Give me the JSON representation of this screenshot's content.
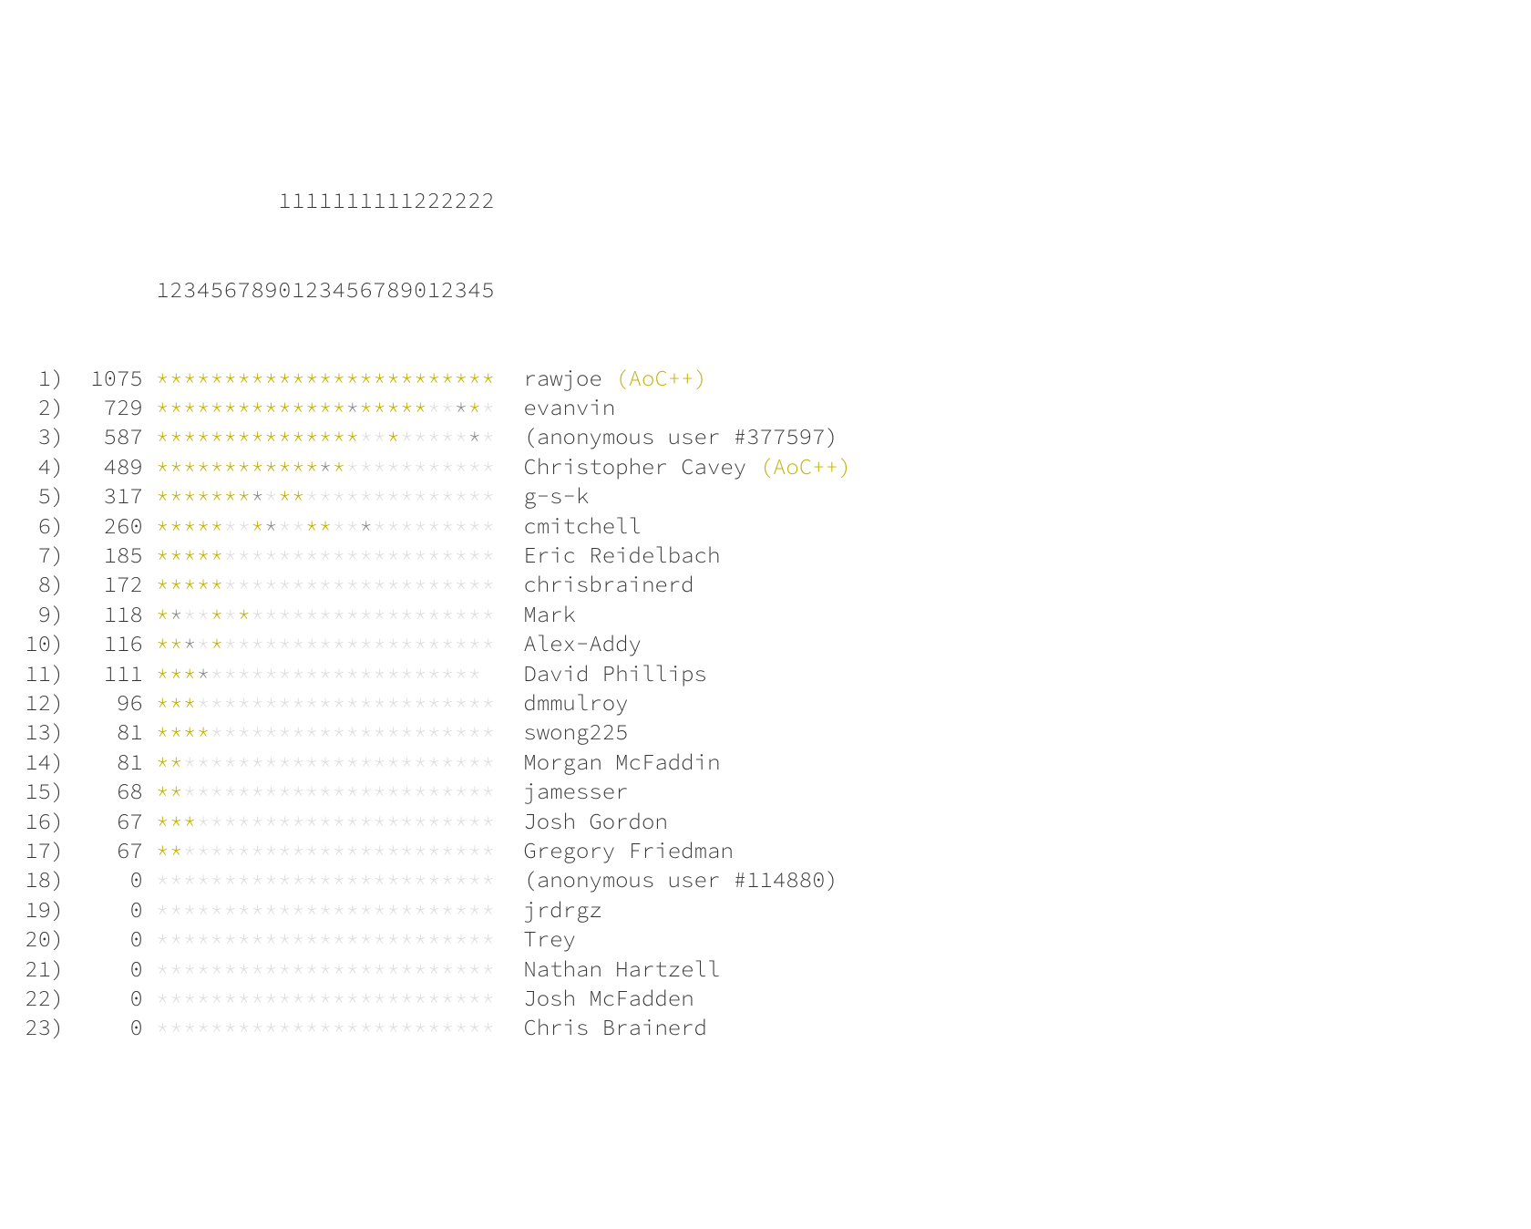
{
  "header": {
    "line1": "         1111111111222222",
    "line2": "1234567890123456789012345"
  },
  "supporter_badge": "(AoC++)",
  "rows": [
    {
      "rank": "1)",
      "score": "1075",
      "stars": "GGGGGGGGGGGGGGGGGGGGGGGGG",
      "name": "rawjoe",
      "supporter": true
    },
    {
      "rank": "2)",
      "score": "729",
      "stars": "GGGGGGGGGGGGGGSGGGGGNNSGN",
      "name": "evanvin",
      "supporter": false
    },
    {
      "rank": "3)",
      "score": "587",
      "stars": "GGGGGGGGGGGGGGGNNGNNNNNSN",
      "name": "(anonymous user #377597)",
      "supporter": false
    },
    {
      "rank": "4)",
      "score": "489",
      "stars": "GGGGGGGGGGGGSGNNNNNNNNNNN",
      "name": "Christopher Cavey",
      "supporter": true
    },
    {
      "rank": "5)",
      "score": "317",
      "stars": "GGGGGGGSNGGNNNNNNNNNNNNNN",
      "name": "g-s-k",
      "supporter": false
    },
    {
      "rank": "6)",
      "score": "260",
      "stars": "GGGGGNNGSNNGGNNSNNNNNNNNN",
      "name": "cmitchell",
      "supporter": false
    },
    {
      "rank": "7)",
      "score": "185",
      "stars": "GGGGGNNNNNNNNNNNNNNNNNNNN",
      "name": "Eric Reidelbach",
      "supporter": false
    },
    {
      "rank": "8)",
      "score": "172",
      "stars": "GGGGGNNNNNNNNNNNNNNNNNNNN",
      "name": "chrisbrainerd",
      "supporter": false
    },
    {
      "rank": "9)",
      "score": "118",
      "stars": "GSNNGNGNNNNNNNNNNNNNNNNNN",
      "name": "Mark",
      "supporter": false
    },
    {
      "rank": "10)",
      "score": "116",
      "stars": "GGSNGNNNNNNNNNNNNNNNNNNNN",
      "name": "Alex-Addy",
      "supporter": false
    },
    {
      "rank": "11)",
      "score": "111",
      "stars": "GGGSNNNNNNNNNNNNNNNNNNNN",
      "name": "David Phillips",
      "supporter": false
    },
    {
      "rank": "12)",
      "score": "96",
      "stars": "GGGNNNNNNNNNNNNNNNNNNNNNN",
      "name": "dmmulroy",
      "supporter": false
    },
    {
      "rank": "13)",
      "score": "81",
      "stars": "GGGGNNNNNNNNNNNNNNNNNNNNN",
      "name": "swong225",
      "supporter": false
    },
    {
      "rank": "14)",
      "score": "81",
      "stars": "GGNNNNNNNNNNNNNNNNNNNNNNN",
      "name": "Morgan McFaddin",
      "supporter": false
    },
    {
      "rank": "15)",
      "score": "68",
      "stars": "GGNNNNNNNNNNNNNNNNNNNNNNN",
      "name": "jamesser",
      "supporter": false
    },
    {
      "rank": "16)",
      "score": "67",
      "stars": "GGGNNNNNNNNNNNNNNNNNNNNNN",
      "name": "Josh Gordon",
      "supporter": false
    },
    {
      "rank": "17)",
      "score": "67",
      "stars": "GGNNNNNNNNNNNNNNNNNNNNNNN",
      "name": "Gregory Friedman",
      "supporter": false
    },
    {
      "rank": "18)",
      "score": "0",
      "stars": "NNNNNNNNNNNNNNNNNNNNNNNNN",
      "name": "(anonymous user #114880)",
      "supporter": false
    },
    {
      "rank": "19)",
      "score": "0",
      "stars": "NNNNNNNNNNNNNNNNNNNNNNNNN",
      "name": "jrdrgz",
      "supporter": false
    },
    {
      "rank": "20)",
      "score": "0",
      "stars": "NNNNNNNNNNNNNNNNNNNNNNNNN",
      "name": "Trey",
      "supporter": false
    },
    {
      "rank": "21)",
      "score": "0",
      "stars": "NNNNNNNNNNNNNNNNNNNNNNNNN",
      "name": "Nathan Hartzell",
      "supporter": false
    },
    {
      "rank": "22)",
      "score": "0",
      "stars": "NNNNNNNNNNNNNNNNNNNNNNNNN",
      "name": "Josh McFadden",
      "supporter": false
    },
    {
      "rank": "23)",
      "score": "0",
      "stars": "NNNNNNNNNNNNNNNNNNNNNNNNN",
      "name": "Chris Brainerd",
      "supporter": false
    }
  ]
}
